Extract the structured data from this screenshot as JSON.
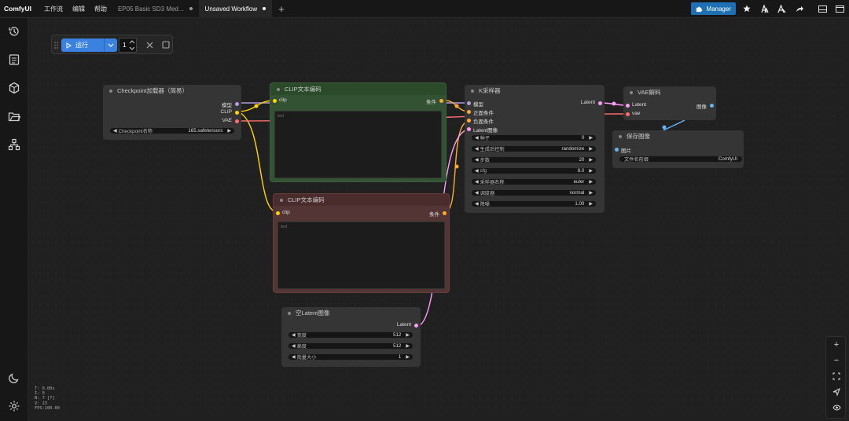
{
  "app": {
    "brand": "ComfyUI",
    "menu": [
      "工作流",
      "编辑",
      "帮助"
    ],
    "tabs": [
      {
        "label": "EP05 Basic SD3 Med...",
        "active": false
      },
      {
        "label": "Unsaved Workflow",
        "active": true
      }
    ],
    "manager_label": "Manager"
  },
  "toolbar": {
    "run_label": "运行",
    "batch_count": "1"
  },
  "sidebar_icons": [
    "history-icon",
    "queue-icon",
    "model-library-icon",
    "workflows-icon",
    "node-library-icon",
    "theme-toggle-icon",
    "settings-icon"
  ],
  "nodes": {
    "checkpoint": {
      "title": "Checkpoint加载器（简易）",
      "outputs": [
        "模型",
        "CLIP",
        "VAE"
      ],
      "widget_label": "Checkpoint名称",
      "widget_value": "165.safetensors"
    },
    "clip_positive": {
      "title": "CLIP文本编码",
      "input": "clip",
      "output": "条件",
      "text_placeholder": "text"
    },
    "clip_negative": {
      "title": "CLIP文本编码",
      "input": "clip",
      "output": "条件",
      "text_placeholder": "text"
    },
    "ksampler": {
      "title": "K采样器",
      "inputs": [
        "模型",
        "正面条件",
        "负面条件",
        "Latent图像"
      ],
      "output": "Latent",
      "widgets": [
        {
          "label": "种子",
          "value": "0"
        },
        {
          "label": "生成后控制",
          "value": "randomize"
        },
        {
          "label": "步数",
          "value": "20"
        },
        {
          "label": "cfg",
          "value": "8.0"
        },
        {
          "label": "采样器名称",
          "value": "euler"
        },
        {
          "label": "调度器",
          "value": "normal"
        },
        {
          "label": "降噪",
          "value": "1.00"
        }
      ]
    },
    "vae_decode": {
      "title": "VAE解码",
      "inputs": [
        "Latent",
        "vae"
      ],
      "output": "图像"
    },
    "save_image": {
      "title": "保存图像",
      "input": "图片",
      "widget_label": "文件名前缀",
      "widget_value": "ComfyUI"
    },
    "empty_latent": {
      "title": "空Latent图像",
      "output": "Latent",
      "widgets": [
        {
          "label": "宽度",
          "value": "512"
        },
        {
          "label": "高度",
          "value": "512"
        },
        {
          "label": "批量大小",
          "value": "1"
        }
      ]
    }
  },
  "stats": [
    "T: 0.00s",
    "I: 0",
    "N: 7 [7]",
    "V: 23",
    "FPS:100.00"
  ],
  "colors": {
    "model": "#b39ddb",
    "clip": "#ffd500",
    "vae": "#ff6e6e",
    "conditioning": "#ffa931",
    "latent": "#ff9cf9",
    "image": "#64b5f6",
    "accent": "#3b82e0"
  }
}
